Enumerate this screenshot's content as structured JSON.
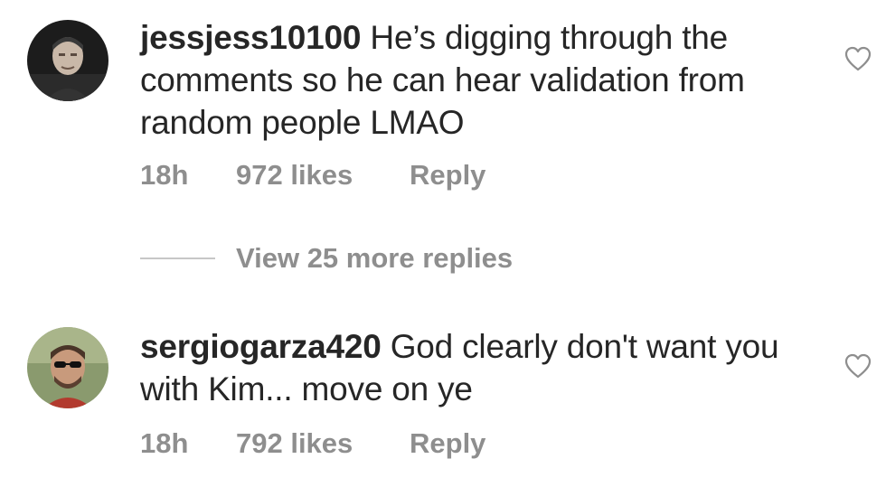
{
  "comments": [
    {
      "username": "jessjess10100",
      "text": "He’s digging through the comments so he can hear validation from random people LMAO",
      "time": "18h",
      "likes": "972 likes",
      "reply": "Reply",
      "avatar_icon": "avatar-photo",
      "like_icon": "heart-outline-icon"
    },
    {
      "username": "sergiogarza420",
      "text": "God clearly don't want you with Kim... move on ye",
      "time": "18h",
      "likes": "792 likes",
      "reply": "Reply",
      "avatar_icon": "avatar-photo",
      "like_icon": "heart-outline-icon"
    }
  ],
  "view_replies": "View 25 more replies",
  "colors": {
    "text": "#262626",
    "secondary": "#8e8e8e",
    "divider": "#c7c7c7"
  }
}
